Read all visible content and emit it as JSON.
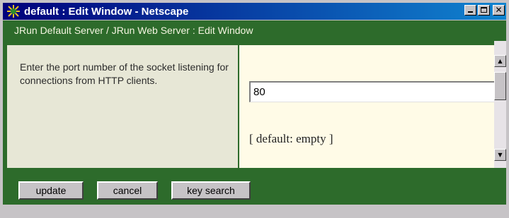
{
  "window": {
    "title": "default : Edit Window - Netscape"
  },
  "header": {
    "breadcrumb": "JRun Default Server / JRun Web Server : Edit Window"
  },
  "form": {
    "description": "Enter the port number of the socket listening for connections from HTTP clients.",
    "port_value": "80",
    "default_note": "[ default: empty ]"
  },
  "buttons": {
    "update": "update",
    "cancel": "cancel",
    "key_search": "key search"
  },
  "colors": {
    "accent_green": "#2d6b2b",
    "titlebar": "#00007b",
    "panel_left": "#e7e7d6",
    "panel_right": "#fffbe7"
  },
  "icons": {
    "app": "netscape-icon",
    "minimize": "minimize-icon",
    "maximize": "maximize-icon",
    "close": "close-icon"
  }
}
